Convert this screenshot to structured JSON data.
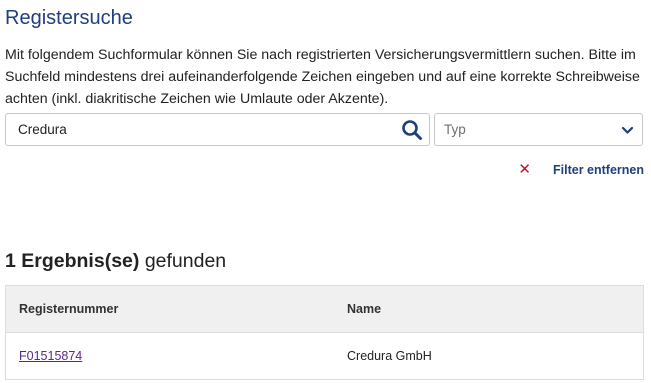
{
  "page": {
    "title": "Registersuche",
    "intro": "Mit folgendem Suchformular können Sie nach registrierten Versicherungsvermittlern suchen. Bitte im Suchfeld mindestens drei aufeinanderfolgende Zeichen eingeben und auf eine korrekte Schreibweise achten (inkl. diakritische Zeichen wie Umlaute oder Akzente)."
  },
  "search": {
    "value": "Credura",
    "icon": "search-icon"
  },
  "type_select": {
    "placeholder": "Typ",
    "icon": "chevron-down-icon"
  },
  "filter": {
    "remove_label": "Filter entfernen",
    "remove_icon": "close-icon",
    "remove_icon_color": "#d0101e"
  },
  "results": {
    "count_label": "1 Ergebnis(se)",
    "suffix": "gefunden",
    "columns": [
      "Registernummer",
      "Name"
    ],
    "rows": [
      {
        "registernummer": "F01515874",
        "name": "Credura GmbH"
      }
    ]
  },
  "colors": {
    "title": "#1f3f7d",
    "link": "#5b2a86",
    "header_bg": "#f0f0f0"
  }
}
